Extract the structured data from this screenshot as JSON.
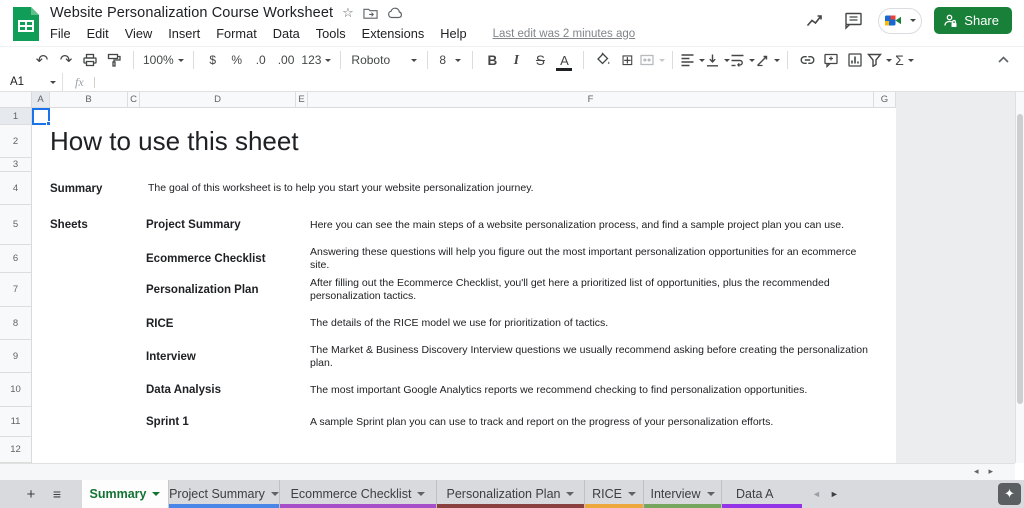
{
  "header": {
    "title": "Website Personalization Course Worksheet",
    "menu": [
      "File",
      "Edit",
      "View",
      "Insert",
      "Format",
      "Data",
      "Tools",
      "Extensions",
      "Help"
    ],
    "last_edit": "Last edit was 2 minutes ago",
    "share_label": "Share"
  },
  "icons": {
    "star": "☆",
    "undo": "↶",
    "redo": "↷",
    "borders": "⊞",
    "sigma": "Σ",
    "plus": "+",
    "all_sheets": "≡",
    "explore": "✦",
    "scroll_left": "◂",
    "scroll_right": "▸",
    "tab_prev": "◄",
    "tab_next": "►"
  },
  "toolbar": {
    "zoom": "100%",
    "currency": "$",
    "percent": "%",
    "decimal_decrease": ".0",
    "decimal_increase": ".00",
    "number_format": "123",
    "font_name": "Roboto",
    "font_size": "8",
    "bold": "B",
    "italic": "I",
    "strikethrough": "S",
    "text_color": "A"
  },
  "formula_bar": {
    "cell_ref": "A1",
    "fx": "fx",
    "value": ""
  },
  "grid": {
    "column_letters": [
      "A",
      "B",
      "C",
      "D",
      "E",
      "F",
      "G"
    ],
    "row_numbers": [
      "1",
      "2",
      "3",
      "4",
      "5",
      "6",
      "7",
      "8",
      "9",
      "10",
      "11",
      "12"
    ],
    "content": {
      "title": "How to use this sheet",
      "summary_label": "Summary",
      "summary_desc": "The goal of this worksheet is to help you start your website personalization journey.",
      "sheets_label": "Sheets",
      "items": [
        {
          "name": "Project Summary",
          "desc": "Here you can see the main steps of a website personalization process, and find a sample project plan you can use."
        },
        {
          "name": "Ecommerce Checklist",
          "desc": "Answering these questions will help you figure out the most important personalization opportunities for an ecommerce site."
        },
        {
          "name": "Personalization Plan",
          "desc": "After filling out the Ecommerce Checklist, you'll get here a prioritized list of opportunities, plus the recommended personalization tactics."
        },
        {
          "name": "RICE",
          "desc": "The details of the RICE model we use for prioritization of tactics."
        },
        {
          "name": "Interview",
          "desc": "The Market & Business Discovery Interview questions we usually recommend asking before creating the personalization plan."
        },
        {
          "name": "Data Analysis",
          "desc": "The most important Google Analytics reports we recommend checking to find personalization opportunities."
        },
        {
          "name": "Sprint 1",
          "desc": "A sample Sprint plan you can use to track and report on the progress of your personalization efforts."
        }
      ]
    }
  },
  "footer": {
    "tabs": [
      {
        "label": "Summary",
        "active": true,
        "underline": ""
      },
      {
        "label": "Project Summary",
        "underline": "#4a86e8"
      },
      {
        "label": "Ecommerce Checklist",
        "underline": "#a64fc8"
      },
      {
        "label": "Personalization Plan",
        "underline": "#8b4040"
      },
      {
        "label": "RICE",
        "underline": "#eda73c"
      },
      {
        "label": "Interview",
        "underline": "#76a55e"
      },
      {
        "label": "Data A",
        "underline": "#9334e6"
      }
    ]
  },
  "colors": {
    "share_green": "#188038",
    "active_tab_green": "#137333",
    "selection_blue": "#1a73e8",
    "logo_green": "#0f9d58"
  }
}
